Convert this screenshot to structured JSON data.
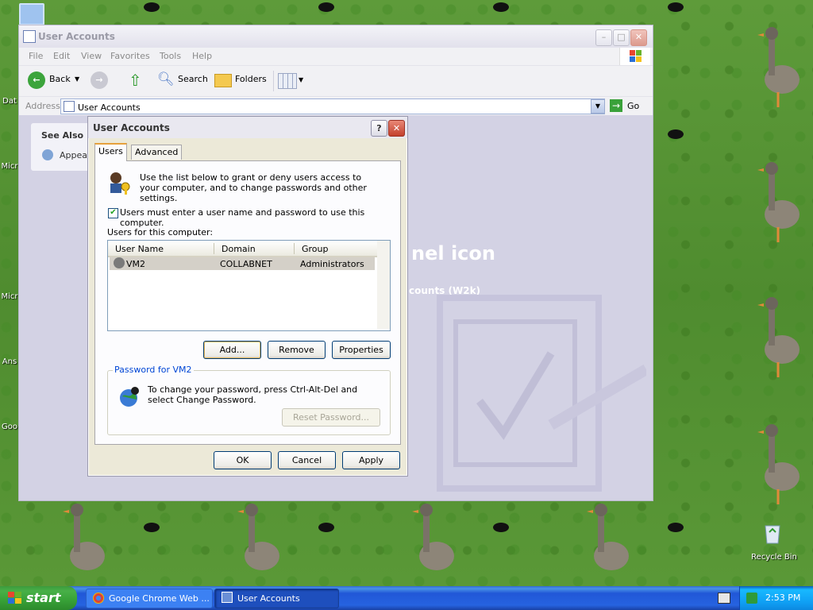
{
  "desktop": {
    "icons": [
      {
        "label": "Dat"
      },
      {
        "label": "Micr"
      },
      {
        "label": "Micr"
      },
      {
        "label": "Ans"
      },
      {
        "label": "Goo"
      },
      {
        "label": "Recycle Bin"
      }
    ]
  },
  "explorer": {
    "title": "User Accounts",
    "menu": [
      "File",
      "Edit",
      "View",
      "Favorites",
      "Tools",
      "Help"
    ],
    "toolbar": {
      "back": "Back",
      "search": "Search",
      "folders": "Folders"
    },
    "address_label": "Address",
    "address_value": "User Accounts",
    "go": "Go",
    "see_also": {
      "title": "See Also",
      "item": "Appear"
    },
    "background_text": {
      "line1": "nel icon",
      "line2": "counts (W2k)"
    }
  },
  "dialog": {
    "title": "User Accounts",
    "help": "?",
    "close": "✕",
    "tabs": [
      "Users",
      "Advanced"
    ],
    "intro": "Use the list below to grant or deny users access to your computer, and to change passwords and other settings.",
    "require_login": {
      "checked": true,
      "label": "Users must enter a user name and password to use this computer."
    },
    "users_label": "Users for this computer:",
    "columns": [
      "User Name",
      "Domain",
      "Group"
    ],
    "users": [
      {
        "name": "VM2",
        "domain": "COLLABNET",
        "group": "Administrators"
      }
    ],
    "buttons": {
      "add": "Add...",
      "remove": "Remove",
      "properties": "Properties"
    },
    "password_group": {
      "title": "Password for VM2",
      "text": "To change your password, press Ctrl-Alt-Del and select Change Password.",
      "reset": "Reset Password..."
    },
    "footer": {
      "ok": "OK",
      "cancel": "Cancel",
      "apply": "Apply"
    }
  },
  "taskbar": {
    "start": "start",
    "tasks": [
      {
        "label": "Google Chrome Web ..."
      },
      {
        "label": "User Accounts"
      }
    ],
    "clock": "2:53 PM"
  }
}
